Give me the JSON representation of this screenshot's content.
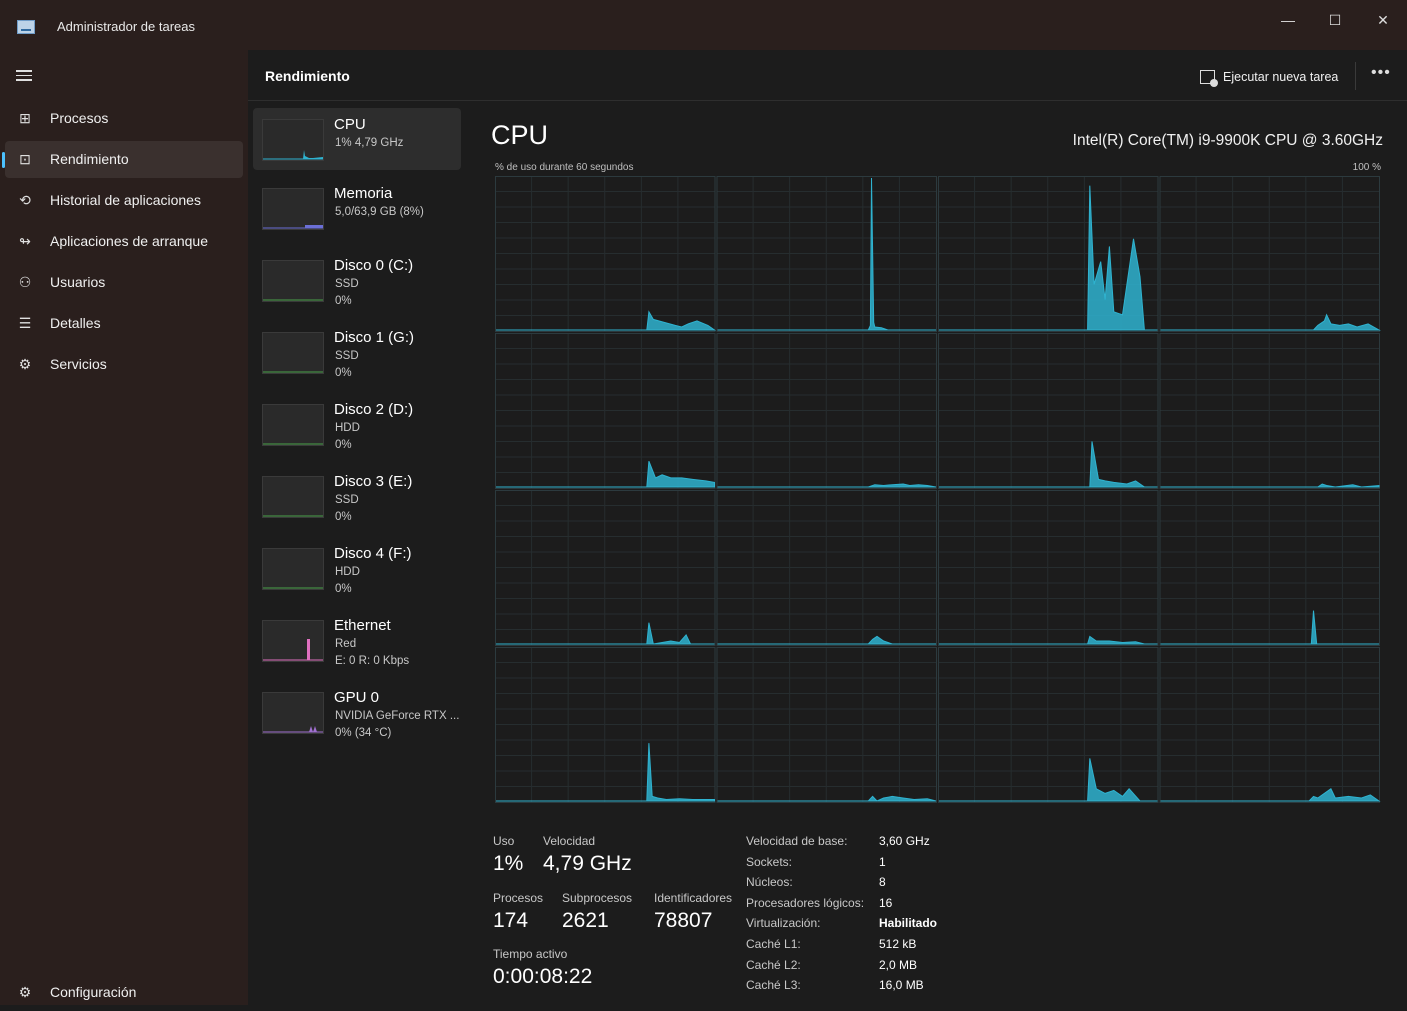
{
  "window": {
    "title": "Administrador de tareas",
    "minimize_icon": "minimize-icon",
    "maximize_icon": "maximize-icon",
    "close_icon": "close-icon"
  },
  "sidebar": {
    "items": [
      {
        "label": "Procesos",
        "icon": "processes-icon"
      },
      {
        "label": "Rendimiento",
        "icon": "performance-icon",
        "active": true
      },
      {
        "label": "Historial de aplicaciones",
        "icon": "history-icon"
      },
      {
        "label": "Aplicaciones de arranque",
        "icon": "startup-icon"
      },
      {
        "label": "Usuarios",
        "icon": "users-icon"
      },
      {
        "label": "Detalles",
        "icon": "details-icon"
      },
      {
        "label": "Servicios",
        "icon": "services-icon"
      }
    ],
    "settings_label": "Configuración"
  },
  "header": {
    "title": "Rendimiento",
    "run_task_label": "Ejecutar nueva tarea"
  },
  "devices": [
    {
      "name": "CPU",
      "line1": "1% 4,79 GHz",
      "line2": "",
      "color": "#2fb3d0"
    },
    {
      "name": "Memoria",
      "line1": "5,0/63,9 GB (8%)",
      "line2": "",
      "color": "#6b6fd6"
    },
    {
      "name": "Disco 0 (C:)",
      "line1": "SSD",
      "line2": "0%",
      "color": "#4ba34b"
    },
    {
      "name": "Disco 1 (G:)",
      "line1": "SSD",
      "line2": "0%",
      "color": "#4ba34b"
    },
    {
      "name": "Disco 2 (D:)",
      "line1": "HDD",
      "line2": "0%",
      "color": "#4ba34b"
    },
    {
      "name": "Disco 3 (E:)",
      "line1": "SSD",
      "line2": "0%",
      "color": "#4ba34b"
    },
    {
      "name": "Disco 4 (F:)",
      "line1": "HDD",
      "line2": "0%",
      "color": "#4ba34b"
    },
    {
      "name": "Ethernet",
      "line1": "Red",
      "line2": "E: 0 R: 0 Kbps",
      "color": "#e070c0"
    },
    {
      "name": "GPU 0",
      "line1": "NVIDIA GeForce RTX ...",
      "line2": "0% (34 °C)",
      "color": "#a070d0"
    }
  ],
  "cpu": {
    "title": "CPU",
    "model": "Intel(R) Core(TM) i9-9900K CPU @ 3.60GHz",
    "graph_label": "% de uso durante 60 segundos",
    "graph_max": "100 %",
    "accent": "#2fb3d0",
    "stats": {
      "uso_label": "Uso",
      "uso": "1%",
      "velocidad_label": "Velocidad",
      "velocidad": "4,79 GHz",
      "procesos_label": "Procesos",
      "procesos": "174",
      "subprocesos_label": "Subprocesos",
      "subprocesos": "2621",
      "identificadores_label": "Identificadores",
      "identificadores": "78807",
      "tiempo_label": "Tiempo activo",
      "tiempo": "0:00:08:22"
    },
    "specs": [
      {
        "k": "Velocidad de base:",
        "v": "3,60 GHz",
        "bold": false
      },
      {
        "k": "Sockets:",
        "v": "1",
        "bold": false
      },
      {
        "k": "Núcleos:",
        "v": "8",
        "bold": false
      },
      {
        "k": "Procesadores lógicos:",
        "v": "16",
        "bold": false
      },
      {
        "k": "Virtualización:",
        "v": "Habilitado",
        "bold": true
      },
      {
        "k": "Caché L1:",
        "v": "512 kB",
        "bold": false
      },
      {
        "k": "Caché L2:",
        "v": "2,0 MB",
        "bold": false
      },
      {
        "k": "Caché L3:",
        "v": "16,0 MB",
        "bold": false
      }
    ]
  }
}
